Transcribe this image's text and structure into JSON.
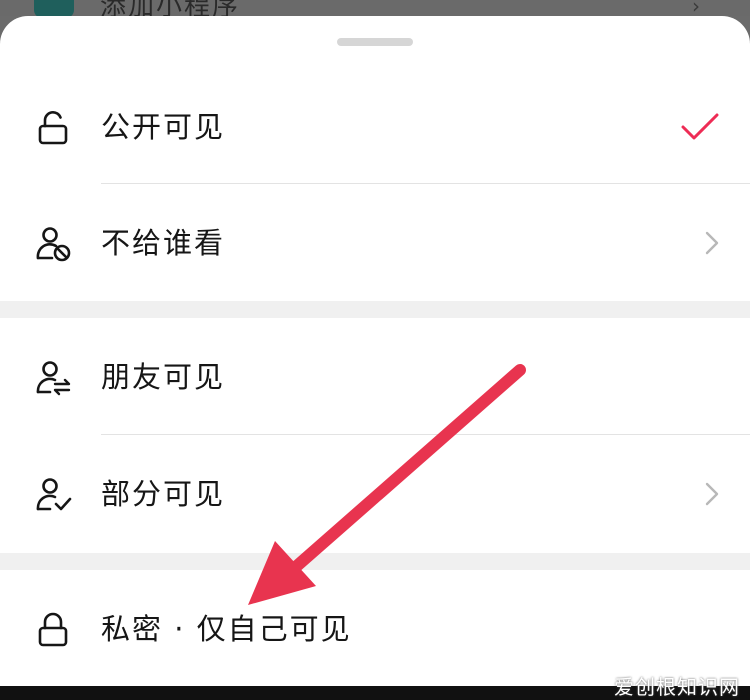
{
  "background": {
    "app_name": "添加小程序"
  },
  "options": [
    {
      "label": "公开可见",
      "icon": "unlock-icon",
      "selected": true,
      "has_chevron": false
    },
    {
      "label": "不给谁看",
      "icon": "user-block-icon",
      "selected": false,
      "has_chevron": true
    },
    {
      "label": "朋友可见",
      "icon": "user-swap-icon",
      "selected": false,
      "has_chevron": false
    },
    {
      "label": "部分可见",
      "icon": "user-check-icon",
      "selected": false,
      "has_chevron": true
    },
    {
      "label": "私密 · 仅自己可见",
      "icon": "lock-icon",
      "selected": false,
      "has_chevron": false
    }
  ],
  "watermark": "爱创根知识网",
  "colors": {
    "accent": "#ee2c55",
    "annotation_arrow": "#e8344f"
  }
}
